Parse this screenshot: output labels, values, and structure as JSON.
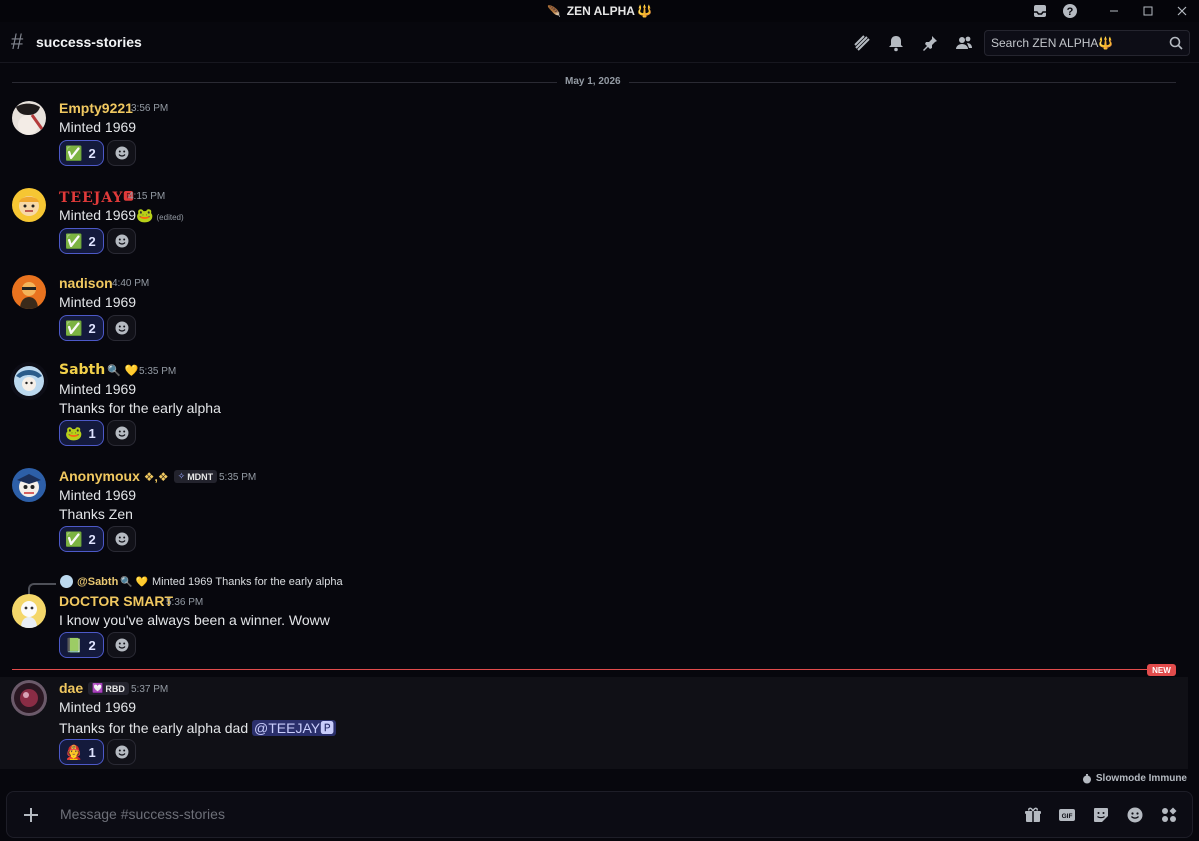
{
  "window": {
    "title": "ZEN ALPHA",
    "title_emoji": "🔱",
    "icons": [
      "inbox-icon",
      "help-icon",
      "minimize-icon",
      "maximize-icon",
      "close-icon"
    ]
  },
  "header": {
    "channel": "success-stories",
    "icons": [
      "threads-icon",
      "bell-icon",
      "pin-icon",
      "members-icon"
    ],
    "search_placeholder": "Search ZEN ALPHA🔱"
  },
  "date_divider": "May 1, 2026",
  "messages": [
    {
      "author": "Empty9221",
      "author_color": "#f0c860",
      "time": "3:56 PM",
      "lines": [
        "Minted 1969"
      ],
      "reaction_emoji": "✅",
      "reaction_count": "2"
    },
    {
      "author": "TEEJAY",
      "author_color": "#e03a3a",
      "author_suffix": "🅿",
      "time": "4:15 PM",
      "lines": [
        "Minted 1969"
      ],
      "inline_emoji": "🐸",
      "edited": "(edited)",
      "reaction_emoji": "✅",
      "reaction_count": "2"
    },
    {
      "author": "nadison",
      "author_color": "#f0c860",
      "time": "4:40 PM",
      "lines": [
        "Minted 1969"
      ],
      "reaction_emoji": "✅",
      "reaction_count": "2"
    },
    {
      "author": "Sabth",
      "author_color": "#f2d04a",
      "author_suffix": "🔍 💛",
      "time": "5:35 PM",
      "lines": [
        "Minted 1969",
        "Thanks for the early alpha"
      ],
      "reaction_emoji": "🐸",
      "reaction_count": "1"
    },
    {
      "author": "Anonymoux",
      "author_color": "#f0c860",
      "author_suffix": "❖,❖",
      "badge": "MDNT",
      "time": "5:35 PM",
      "lines": [
        "Minted 1969",
        "Thanks Zen"
      ],
      "reaction_emoji": "✅",
      "reaction_count": "2"
    },
    {
      "author": "DOCTOR SMART",
      "author_color": "#f0c860",
      "time": "5:36 PM",
      "reply_to": "@Sabth",
      "reply_suffix": "🔍 💛",
      "reply_text": "Minted 1969 Thanks for the early alpha",
      "lines": [
        "I know you've always been a winner. Woww"
      ],
      "reaction_emoji": "📗",
      "reaction_count": "2"
    },
    {
      "author": "dae",
      "author_color": "#f0c860",
      "badge": "RBD",
      "time": "5:37 PM",
      "lines": [
        "Minted 1969",
        "Thanks for the early alpha dad"
      ],
      "mention": "@TEEJAY🅿",
      "reaction_emoji": "🧑‍🚒",
      "reaction_count": "1"
    }
  ],
  "new_label": "NEW",
  "slowmode": "Slowmode Immune",
  "composer": {
    "placeholder": "Message #success-stories",
    "icons": [
      "plus-icon",
      "gift-icon",
      "gif-icon",
      "sticker-icon",
      "emoji-icon",
      "apps-icon"
    ]
  },
  "colors": {
    "background": "#07070d",
    "accent": "#4d59c8",
    "new_divider": "#e24c4c",
    "username": "#f0c860"
  }
}
